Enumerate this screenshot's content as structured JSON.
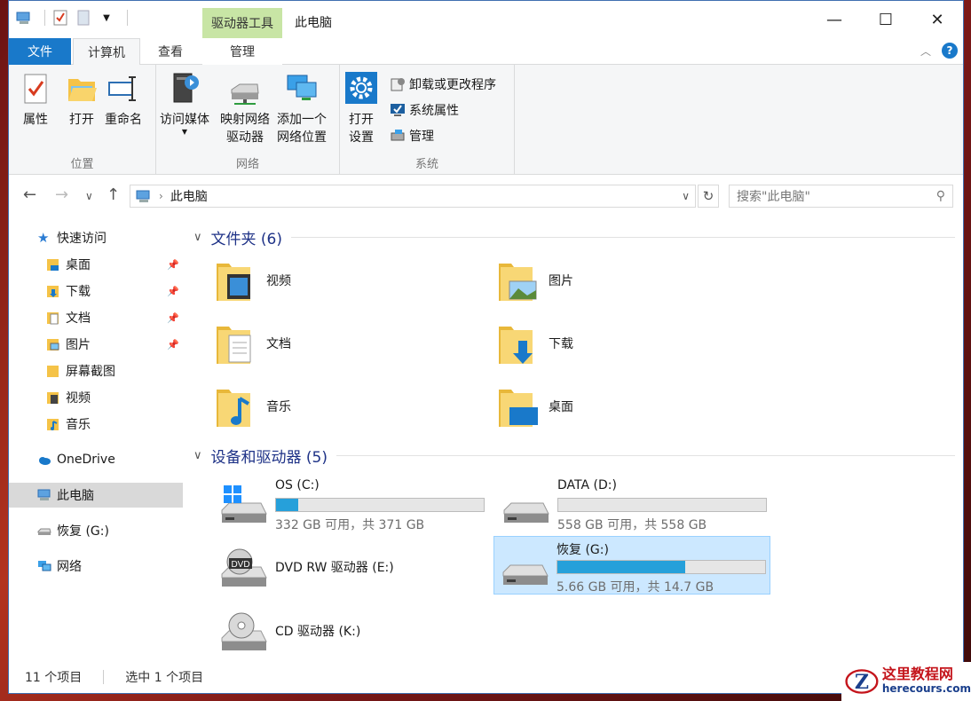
{
  "window": {
    "title": "此电脑",
    "context_group": "驱动器工具",
    "controls": {
      "minimize": "—",
      "maximize": "☐",
      "close": "✕"
    }
  },
  "tabs": {
    "file": "文件",
    "computer": "计算机",
    "view": "查看",
    "manage": "管理"
  },
  "ribbon": {
    "location": {
      "label": "位置",
      "properties": "属性",
      "open": "打开",
      "rename": "重命名"
    },
    "network": {
      "label": "网络",
      "access_media": "访问媒体",
      "map_drive_1": "映射网络",
      "map_drive_2": "驱动器",
      "add_location_1": "添加一个",
      "add_location_2": "网络位置"
    },
    "system": {
      "label": "系统",
      "open_settings_1": "打开",
      "open_settings_2": "设置",
      "uninstall": "卸载或更改程序",
      "sys_props": "系统属性",
      "manage": "管理"
    }
  },
  "address": {
    "path": "此电脑",
    "search_placeholder": "搜索\"此电脑\""
  },
  "nav": {
    "quick_access": "快速访问",
    "items": [
      "桌面",
      "下载",
      "文档",
      "图片",
      "屏幕截图",
      "视频",
      "音乐"
    ],
    "onedrive": "OneDrive",
    "this_pc": "此电脑",
    "recovery": "恢复 (G:)",
    "network": "网络"
  },
  "folders_section": {
    "title": "文件夹 (6)",
    "items": [
      "视频",
      "图片",
      "文档",
      "下载",
      "音乐",
      "桌面"
    ]
  },
  "drives_section": {
    "title": "设备和驱动器 (5)",
    "drives": [
      {
        "name": "OS (C:)",
        "info": "332 GB 可用，共 371 GB",
        "used_fraction": 0.105
      },
      {
        "name": "DATA (D:)",
        "info": "558 GB 可用，共 558 GB",
        "used_fraction": 0.0
      },
      {
        "name": "DVD RW 驱动器 (E:)"
      },
      {
        "name": "恢复 (G:)",
        "info": "5.66 GB 可用，共 14.7 GB",
        "used_fraction": 0.615
      },
      {
        "name": "CD 驱动器 (K:)"
      }
    ]
  },
  "status": {
    "count": "11 个项目",
    "selected": "选中 1 个项目"
  },
  "watermark": {
    "title": "这里教程网",
    "url": "herecours.com"
  },
  "colors": {
    "accent": "#1979ca",
    "context_tab": "#c8e5a5",
    "drive_fill": "#26a0da",
    "selection": "#cce8ff"
  }
}
